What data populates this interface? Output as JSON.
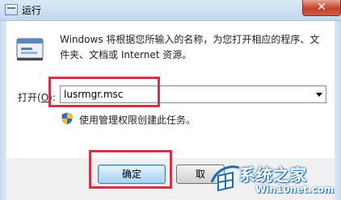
{
  "window": {
    "title": "运行",
    "close_label": "✕"
  },
  "dialog": {
    "description": "Windows 将根据您所输入的名称，为您打开相应的程序、文件夹、文档或 Internet 资源。",
    "open_label_prefix": "打开(",
    "open_label_key": "O",
    "open_label_suffix": "):",
    "command_value": "lusrmgr.msc",
    "admin_note": "使用管理权限创建此任务。"
  },
  "buttons": {
    "ok_label": "确定",
    "cancel_label": "取"
  },
  "watermark": {
    "title": "系统之家",
    "url": "Win10net.com"
  },
  "colors": {
    "highlight": "#d9304a",
    "watermark_blue": "#1b6fb6"
  },
  "icons": [
    "run-icon",
    "uac-shield-icon",
    "close-icon",
    "dropdown-arrow-icon",
    "watermark-logo"
  ]
}
